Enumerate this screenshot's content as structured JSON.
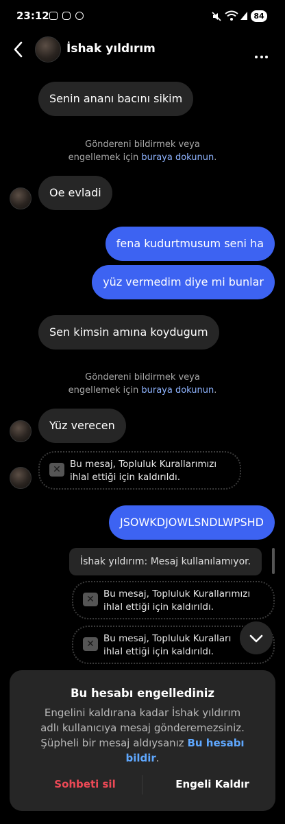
{
  "status_bar": {
    "time": "23:12",
    "battery": "84"
  },
  "header": {
    "name": "İshak yıldırım",
    "back_icon": "chevron-left-icon",
    "more_icon": "more-horizontal-icon"
  },
  "messages": [
    {
      "kind": "in",
      "text": "Senin ananı bacını sikim"
    },
    {
      "kind": "in",
      "text": "Oe evladi"
    },
    {
      "kind": "out",
      "text": "fena kudurtmusum seni ha"
    },
    {
      "kind": "out",
      "text": "yüz vermedim diye mi bunlar"
    },
    {
      "kind": "in",
      "text": "Sen kimsin amına koydugum"
    },
    {
      "kind": "in",
      "text": "Yüz verecen"
    },
    {
      "kind": "out",
      "text": "JSOWKDJOWLSNDLWPSHD"
    }
  ],
  "report_notice": {
    "line1": "Göndereni bildirmek veya",
    "line2_prefix": "engellemek için ",
    "link": "buraya dokunun",
    "suffix": "."
  },
  "removed_notice": {
    "line1": "Bu mesaj, Topluluk Kurallarımızı",
    "line2": "ihlal ettiği için kaldırıldı.",
    "line1_cut": "Bu mesaj, Topluluk Kuralları"
  },
  "unavailable_reply": "İshak yıldırım: Mesaj kullanılamıyor.",
  "blocked_sheet": {
    "title": "Bu hesabı engellediniz",
    "body_line1": "Engelini kaldırana kadar İshak yıldırım",
    "body_line2": "adlı kullanıcıya mesaj gönderemezsiniz.",
    "body_line3": "Şüpheli bir mesaj aldıysanız ",
    "body_link_a": "Bu hesabı",
    "body_link_b": "bildir",
    "body_end": ".",
    "delete_chat": "Sohbeti sil",
    "unblock": "Engeli Kaldır"
  },
  "colors": {
    "outgoing_bubble": "#3d63f2",
    "incoming_bubble": "#262626",
    "link": "#8fb4ff",
    "danger": "#ed4956"
  }
}
